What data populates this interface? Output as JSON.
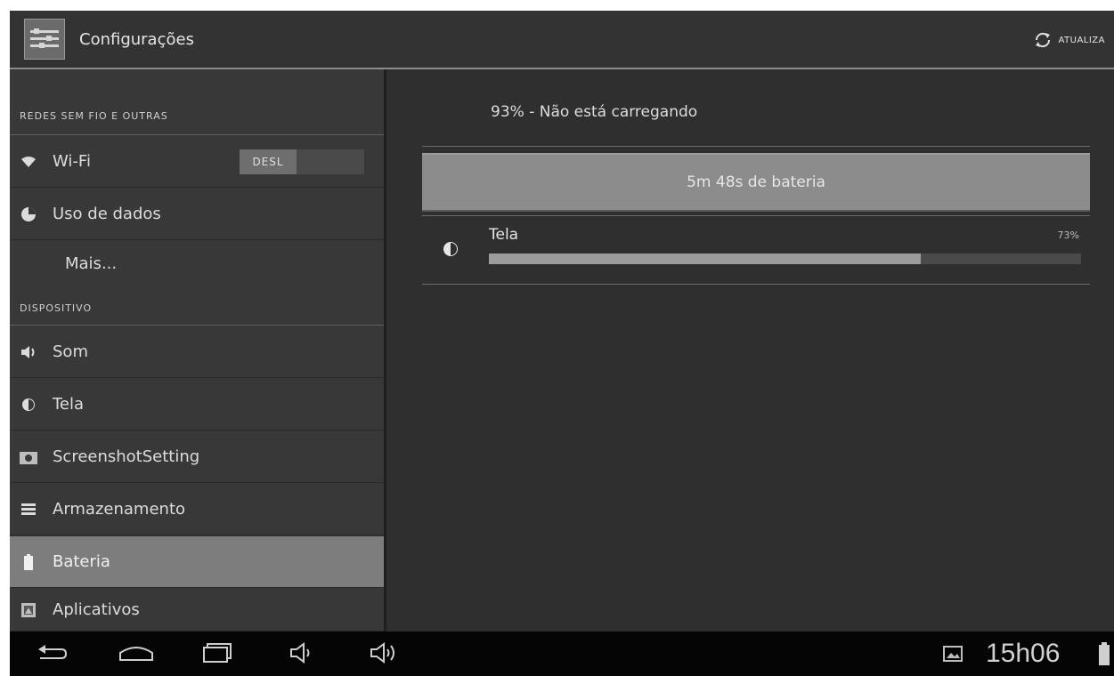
{
  "action_bar": {
    "title": "Configurações",
    "sync_label": "ATUALIZA"
  },
  "sidebar": {
    "sections": [
      {
        "header": "REDES SEM FIO E OUTRAS",
        "items": [
          {
            "label": "Wi-Fi",
            "icon": "wifi-icon",
            "toggle": "DESL"
          },
          {
            "label": "Uso de dados",
            "icon": "data-usage-icon"
          },
          {
            "label": "Mais...",
            "icon": ""
          }
        ]
      },
      {
        "header": "DISPOSITIVO",
        "items": [
          {
            "label": "Som",
            "icon": "sound-icon"
          },
          {
            "label": "Tela",
            "icon": "brightness-icon"
          },
          {
            "label": "ScreenshotSetting",
            "icon": "camera-icon"
          },
          {
            "label": "Armazenamento",
            "icon": "storage-icon"
          },
          {
            "label": "Bateria",
            "icon": "battery-icon",
            "selected": true
          },
          {
            "label": "Aplicativos",
            "icon": "apps-icon"
          }
        ]
      }
    ]
  },
  "battery": {
    "status": "93% - Não está carregando",
    "time_on_battery": "5m 48s de bateria",
    "usage": [
      {
        "label": "Tela",
        "percent_label": "73%",
        "fraction": 0.73,
        "icon": "brightness-icon"
      }
    ]
  },
  "system_bar": {
    "clock": "15h06"
  },
  "colors": {
    "background": "#2b2b2b",
    "selected": "#7d7d7d",
    "accent_bar": "#8c8c8c"
  }
}
